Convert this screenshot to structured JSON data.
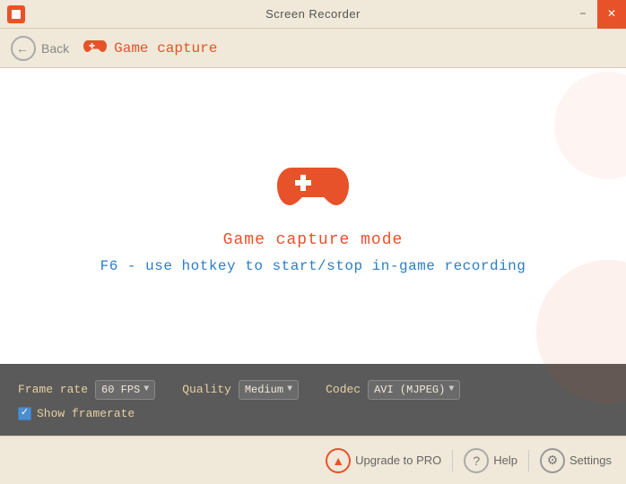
{
  "titlebar": {
    "title": "Screen Recorder",
    "minimize_label": "−",
    "close_label": "✕"
  },
  "navbar": {
    "back_label": "Back",
    "nav_title": "Game capture"
  },
  "main": {
    "mode_title": "Game capture mode",
    "hotkey_text": "F6 - use hotkey to start/stop in-game recording"
  },
  "controls": {
    "frame_rate_label": "Frame rate",
    "frame_rate_value": "60 FPS",
    "quality_label": "Quality",
    "quality_value": "Medium",
    "codec_label": "Codec",
    "codec_value": "AVI (MJPEG)",
    "show_framerate_label": "Show framerate"
  },
  "footer": {
    "upgrade_label": "Upgrade to PRO",
    "help_label": "Help",
    "settings_label": "Settings"
  }
}
